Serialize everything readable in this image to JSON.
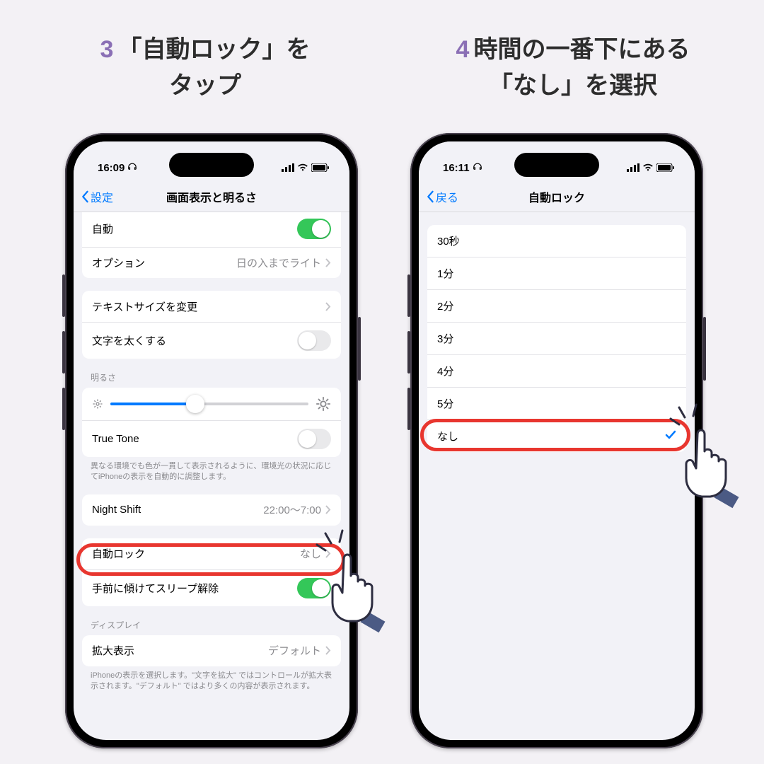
{
  "steps": {
    "s3": {
      "num": "3",
      "text_l1": "「自動ロック」を",
      "text_l2": "タップ"
    },
    "s4": {
      "num": "4",
      "text_l1": "時間の一番下にある",
      "text_l2": "「なし」を選択"
    }
  },
  "phone1": {
    "status_time": "16:09",
    "nav_back": "設定",
    "nav_title": "画面表示と明るさ",
    "row_auto": "自動",
    "row_option": "オプション",
    "row_option_val": "日の入までライト",
    "row_textsize": "テキストサイズを変更",
    "row_bold": "文字を太くする",
    "section_brightness": "明るさ",
    "row_truetone": "True Tone",
    "truetone_note": "異なる環境でも色が一貫して表示されるように、環境光の状況に応じてiPhoneの表示を自動的に調整します。",
    "row_nightshift": "Night Shift",
    "row_nightshift_val": "22:00〜7:00",
    "row_autolock": "自動ロック",
    "row_autolock_val": "なし",
    "row_raise": "手前に傾けてスリープ解除",
    "section_display": "ディスプレイ",
    "row_zoom": "拡大表示",
    "row_zoom_val": "デフォルト",
    "zoom_note": "iPhoneの表示を選択します。\"文字を拡大\" ではコントロールが拡大表示されます。\"デフォルト\" ではより多くの内容が表示されます。"
  },
  "phone2": {
    "status_time": "16:11",
    "nav_back": "戻る",
    "nav_title": "自動ロック",
    "options": [
      "30秒",
      "1分",
      "2分",
      "3分",
      "4分",
      "5分",
      "なし"
    ],
    "selected": "なし"
  }
}
